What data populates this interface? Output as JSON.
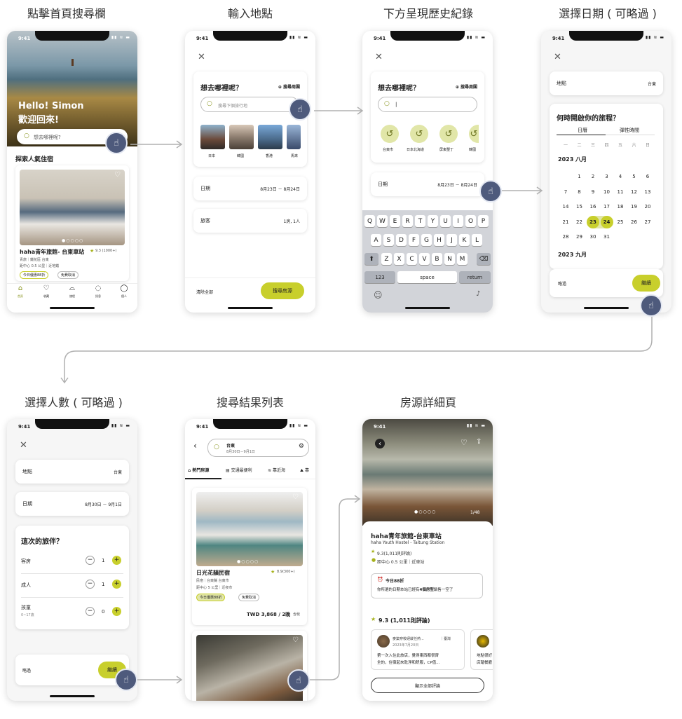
{
  "colors": {
    "accent": "#c8cf2c",
    "accent_light": "#e1e6a8",
    "tap_marker": "#4e5a7c",
    "arrow": "#b0b0b0"
  },
  "status_time": "9:41",
  "titles": [
    "點擊首頁搜尋欄",
    "輸入地點",
    "下方呈現歷史紀錄",
    "選擇日期 ( 可略過 )",
    "選擇人數 ( 可略過 )",
    "搜尋結果列表",
    "房源詳細頁"
  ],
  "screen1": {
    "greeting1": "Hello! Simon",
    "greeting2": "歡迎回來!",
    "search_placeholder": "想去哪裡呢?",
    "section": "探索人氣住宿",
    "listing": {
      "name": "haha青年旅館- 台東車站",
      "rating": "9.3 (1000+)",
      "line1": "青旅｜鐵花區 台東",
      "line2": "距中心 0.5 公里｜近地鐵",
      "badge1": "今日優惠88折",
      "badge2": "免費取消"
    },
    "nav": [
      {
        "icon": "⌂",
        "label": "首頁"
      },
      {
        "icon": "♡",
        "label": "收藏"
      },
      {
        "icon": "⌓",
        "label": "旅程"
      },
      {
        "icon": "◌",
        "label": "訊息"
      },
      {
        "icon": "◯",
        "label": "個人"
      }
    ]
  },
  "screen2": {
    "question": "想去哪裡呢？",
    "nearby": "⊕ 搜尋周圍",
    "placeholder": "搜尋下個旅行地",
    "destinations": [
      "日本",
      "韓國",
      "香港",
      "馬來"
    ],
    "date_label": "日期",
    "date_value": "8月23日 － 8月24日",
    "guest_label": "旅客",
    "guest_value": "1房, 1人",
    "clear": "清除全部",
    "search_btn": "搜尋房源"
  },
  "screen3": {
    "question": "想去哪裡呢？",
    "nearby": "⊕ 搜尋周圍",
    "input_value": "|",
    "history": [
      "台東市",
      "日本北海道",
      "屏東墾丁",
      "韓國"
    ],
    "date_label": "日期",
    "date_value": "8月23日 － 8月24日",
    "rows": [
      [
        "Q",
        "W",
        "E",
        "R",
        "T",
        "Y",
        "U",
        "I",
        "O",
        "P"
      ],
      [
        "A",
        "S",
        "D",
        "F",
        "G",
        "H",
        "J",
        "K",
        "L"
      ],
      [
        "Z",
        "X",
        "C",
        "V",
        "B",
        "N",
        "M"
      ]
    ],
    "k123": "123",
    "space": "space",
    "ret": "return",
    "shift": "⬆",
    "backspace": "⌫",
    "emoji": "☺",
    "mic": "🎤"
  },
  "screen4": {
    "loc_label": "地點",
    "loc_value": "台東",
    "question": "何時開啟你的旅程？",
    "tab1": "日曆",
    "tab2": "彈性時間",
    "weekdays": [
      "一",
      "二",
      "三",
      "四",
      "五",
      "六",
      "日"
    ],
    "month1": "2023 八月",
    "weeks": [
      [
        "",
        "1",
        "2",
        "3",
        "4",
        "5",
        "6"
      ],
      [
        "7",
        "8",
        "9",
        "10",
        "11",
        "12",
        "13"
      ],
      [
        "14",
        "15",
        "16",
        "17",
        "18",
        "19",
        "20"
      ],
      [
        "21",
        "22",
        "23",
        "24",
        "25",
        "26",
        "27"
      ],
      [
        "28",
        "29",
        "30",
        "31",
        "",
        "",
        ""
      ]
    ],
    "month2": "2023 九月",
    "skip": "略過",
    "next": "繼續"
  },
  "screen5": {
    "loc_label": "地點",
    "loc_value": "台東",
    "date_label": "日期",
    "date_value": "8月30日 － 9月1日",
    "question": "這次的旅伴？",
    "rows": [
      {
        "label": "客房",
        "sub": "",
        "value": "1"
      },
      {
        "label": "成人",
        "sub": "",
        "value": "1"
      },
      {
        "label": "孩童",
        "sub": "0~17歲",
        "value": "0"
      }
    ],
    "minus": "−",
    "plus": "+",
    "skip": "略過",
    "next": "繼續"
  },
  "screen6": {
    "search_title": "台東",
    "search_sub": "8月30日－9月1日",
    "tabs": [
      {
        "icon": "⌂",
        "label": "熱門房源"
      },
      {
        "icon": "▤",
        "label": "交通最便利"
      },
      {
        "icon": "≋",
        "label": "靠近海"
      },
      {
        "icon": "⛰",
        "label": "靠"
      }
    ],
    "listing": {
      "name": "日光花韻民宿",
      "rating": "8.9(300+)",
      "line1": "民宿｜台東縣 台東市",
      "line2": "距中心 5 公里｜近夜市",
      "badge1": "今日優惠88折",
      "badge2": "免費取消",
      "price": "TWD 3,868 / 2晚",
      "tax": "含稅"
    }
  },
  "screen7": {
    "photo_count": "1/48",
    "name": "haha青年旅館-台東車站",
    "name_en": "haha Youth Hostel - Taitung Station",
    "rating": "9.3(1,011則評論)",
    "distance": "距中心 0.5 公里｜近車站",
    "deal_title": "今日88折",
    "deal_text_a": "你所選的日期本站已經有",
    "deal_bold": "4個房型",
    "deal_text_b": "銷售一空了",
    "reviews_header": "9.3 (1,011則評論)",
    "review1": {
      "name": "麥築穿梭絕縱任熱...",
      "place": "｜臺灣",
      "date": "2023年7月20日",
      "text1": "第一次入住此旅店，覺得東西都很齊",
      "text2": "全的，住宿起來乾淨和舒服，CP值..."
    },
    "review2": {
      "text1": "地點很好",
      "text2": "店踏餐廳"
    },
    "show_all": "顯示全部評論"
  }
}
